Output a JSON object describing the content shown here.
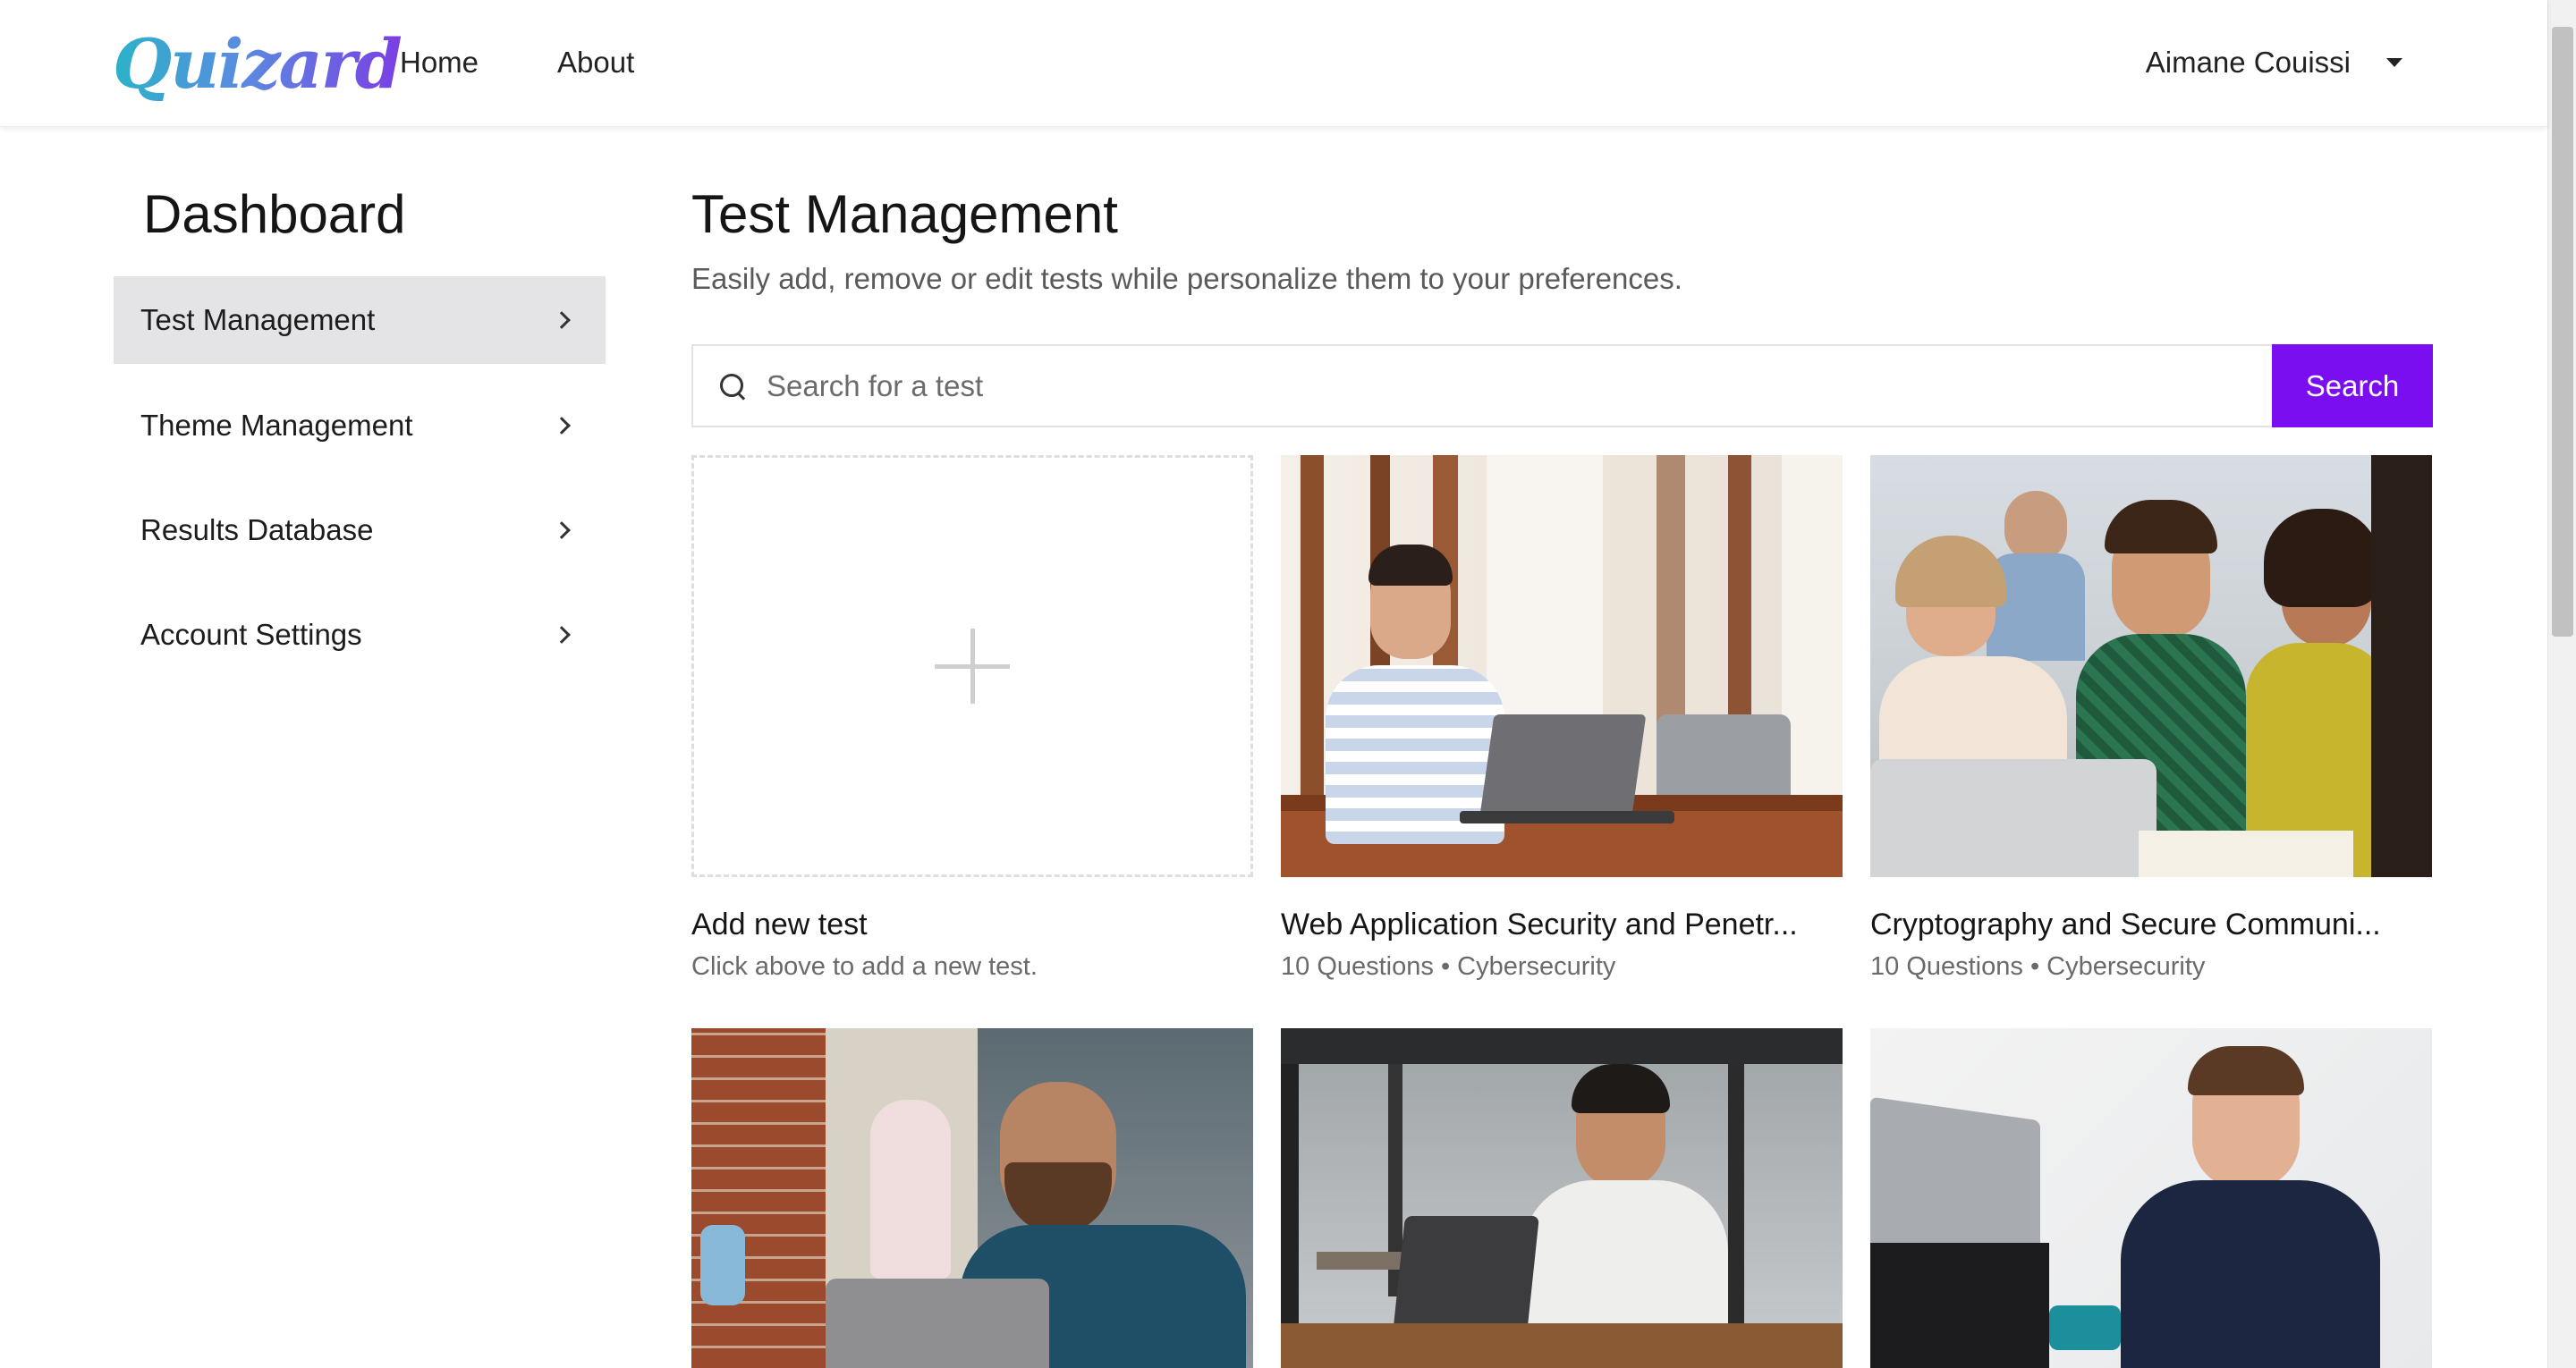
{
  "navbar": {
    "logo": "Quizard",
    "links": [
      "Home",
      "About"
    ],
    "user_name": "Aimane Couissi"
  },
  "sidebar": {
    "title": "Dashboard",
    "items": [
      {
        "label": "Test Management",
        "active": true
      },
      {
        "label": "Theme Management",
        "active": false
      },
      {
        "label": "Results Database",
        "active": false
      },
      {
        "label": "Account Settings",
        "active": false
      }
    ]
  },
  "main": {
    "title": "Test Management",
    "subtitle": "Easily add, remove or edit tests while personalize them to your preferences.",
    "search": {
      "placeholder": "Search for a test",
      "button_label": "Search"
    },
    "add_card": {
      "title": "Add new test",
      "subtitle": "Click above to add a new test."
    },
    "tests": [
      {
        "title": "Web Application Security and Penetr...",
        "meta": "10 Questions • Cybersecurity"
      },
      {
        "title": "Cryptography and Secure Communi...",
        "meta": "10 Questions • Cybersecurity"
      }
    ]
  },
  "colors": {
    "accent": "#7a0ef0",
    "active_sidebar_bg": "#e4e4e7"
  }
}
